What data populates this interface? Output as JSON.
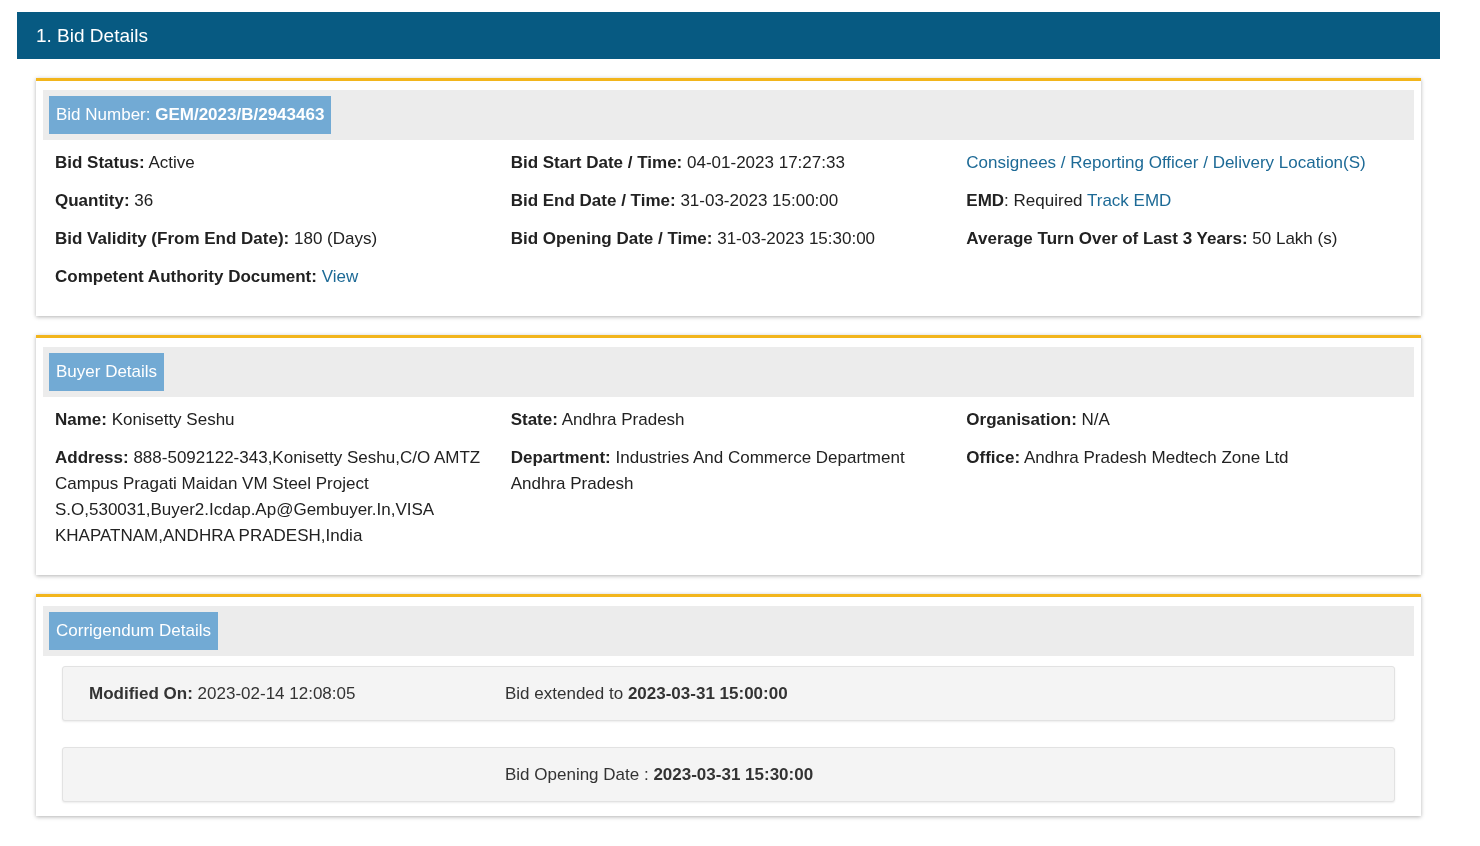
{
  "header": {
    "title": "1. Bid Details"
  },
  "sections": [
    {
      "kind": "fields",
      "badge": "Bid Number: **GEM/2023/B/2943463**",
      "columns": [
        [
          {
            "text": "**Bid Status:** Active"
          },
          {
            "text": "**Quantity:** 36"
          },
          {
            "text": "**Bid Validity (From End Date):** 180 (Days)"
          },
          {
            "text": "**Competent Authority Document:**",
            "link": "View"
          }
        ],
        [
          {
            "text": "**Bid Start Date / Time:** 04-01-2023 17:27:33"
          },
          {
            "text": "**Bid End Date / Time:** 31-03-2023 15:00:00"
          },
          {
            "text": "**Bid Opening Date / Time:** 31-03-2023 15:30:00"
          }
        ],
        [
          {
            "link": "Consignees / Reporting Officer / Delivery Location(S)"
          },
          {
            "text": "**EMD**: Required",
            "link": "Track EMD"
          },
          {
            "text": "**Average Turn Over of Last 3 Years:** 50 Lakh (s)"
          }
        ]
      ]
    },
    {
      "kind": "fields",
      "badge": "Buyer Details",
      "columns": [
        [
          {
            "text": "**Name:** Konisetty Seshu"
          },
          {
            "text": "**Address:** 888-5092122-343,Konisetty Seshu,C/O AMTZ Campus Pragati Maidan VM Steel Project S.O,530031,Buyer2.Icdap.Ap@Gembuyer.In,VISA KHAPATNAM,ANDHRA PRADESH,India"
          }
        ],
        [
          {
            "text": "**State:** Andhra Pradesh"
          },
          {
            "text": "**Department:** Industries And Commerce Department Andhra Pradesh"
          }
        ],
        [
          {
            "text": "**Organisation:** N/A"
          },
          {
            "text": "**Office:** Andhra Pradesh Medtech Zone Ltd"
          }
        ]
      ]
    },
    {
      "kind": "rows",
      "badge": "Corrigendum Details",
      "rows": [
        {
          "left": "**Modified On:** 2023-02-14 12:08:05",
          "right": "Bid extended to **2023-03-31 15:00:00**"
        },
        {
          "right": "Bid Opening Date : **2023-03-31 15:30:00**"
        }
      ]
    }
  ]
}
